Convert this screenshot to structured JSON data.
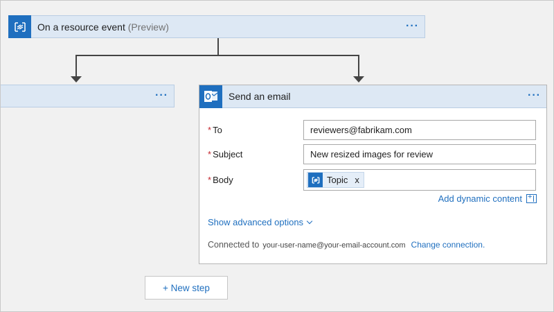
{
  "trigger": {
    "title": "On a resource event",
    "suffix": "(Preview)",
    "icon": "event-grid-icon",
    "more": "···"
  },
  "left_step": {
    "more": "···"
  },
  "email_step": {
    "title": "Send an email",
    "icon": "outlook-icon",
    "more": "···",
    "required_marker": "*",
    "fields": {
      "to": {
        "label": "To",
        "value": "reviewers@fabrikam.com"
      },
      "subject": {
        "label": "Subject",
        "value": "New resized images for review"
      },
      "body": {
        "label": "Body",
        "token_label": "Topic",
        "token_close": "x",
        "token_icon": "event-grid-icon"
      }
    },
    "add_dynamic_content": "Add dynamic content",
    "show_advanced": "Show advanced options",
    "connected_to_label": "Connected to",
    "connected_account": "your-user-name@your-email-account.com",
    "change_connection": "Change connection."
  },
  "new_step": "+ New step",
  "colors": {
    "accent": "#1f6fbf",
    "header_bg": "#dde8f4",
    "required": "#c4262e",
    "canvas": "#f1f1f1"
  }
}
